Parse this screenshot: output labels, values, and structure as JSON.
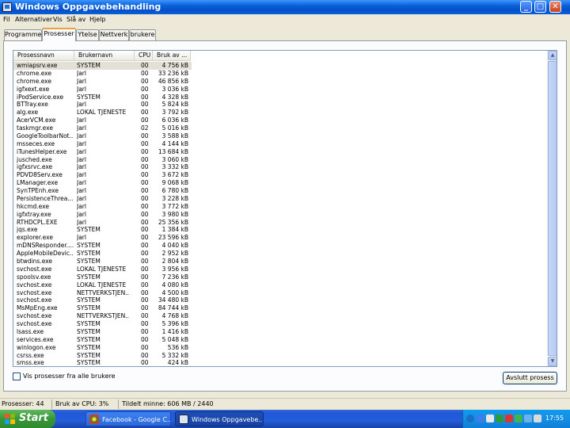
{
  "window": {
    "title": "Windows Oppgavebehandling"
  },
  "menu": {
    "items": [
      "Fil",
      "Alternativer",
      "Vis",
      "Slå av",
      "Hjelp"
    ]
  },
  "tabs": [
    {
      "label": "Programmer",
      "active": false
    },
    {
      "label": "Prosesser",
      "active": true
    },
    {
      "label": "Ytelse",
      "active": false
    },
    {
      "label": "Nettverk",
      "active": false
    },
    {
      "label": "brukere",
      "active": false
    }
  ],
  "table": {
    "columns": [
      "Prosessnavn",
      "Brukernavn",
      "CPU",
      "Bruk av ..."
    ],
    "rows": [
      [
        "wmiapsrv.exe",
        "SYSTEM",
        "00",
        "4 756 kB"
      ],
      [
        "chrome.exe",
        "Jarl",
        "00",
        "33 236 kB"
      ],
      [
        "chrome.exe",
        "Jarl",
        "00",
        "46 856 kB"
      ],
      [
        "igfxext.exe",
        "Jarl",
        "00",
        "3 036 kB"
      ],
      [
        "iPodService.exe",
        "SYSTEM",
        "00",
        "4 328 kB"
      ],
      [
        "BTTray.exe",
        "Jarl",
        "00",
        "5 824 kB"
      ],
      [
        "alg.exe",
        "LOKAL TJENESTE",
        "00",
        "3 792 kB"
      ],
      [
        "AcerVCM.exe",
        "Jarl",
        "00",
        "6 036 kB"
      ],
      [
        "taskmgr.exe",
        "Jarl",
        "02",
        "5 016 kB"
      ],
      [
        "GoogleToolbarNot...",
        "Jarl",
        "00",
        "3 588 kB"
      ],
      [
        "msseces.exe",
        "Jarl",
        "00",
        "4 144 kB"
      ],
      [
        "iTunesHelper.exe",
        "Jarl",
        "00",
        "13 684 kB"
      ],
      [
        "jusched.exe",
        "Jarl",
        "00",
        "3 060 kB"
      ],
      [
        "igfxsrvc.exe",
        "Jarl",
        "00",
        "3 332 kB"
      ],
      [
        "PDVD8Serv.exe",
        "Jarl",
        "00",
        "3 672 kB"
      ],
      [
        "LManager.exe",
        "Jarl",
        "00",
        "9 068 kB"
      ],
      [
        "SynTPEnh.exe",
        "Jarl",
        "00",
        "6 780 kB"
      ],
      [
        "PersistenceThrea...",
        "Jarl",
        "00",
        "3 228 kB"
      ],
      [
        "hkcmd.exe",
        "Jarl",
        "00",
        "3 772 kB"
      ],
      [
        "igfxtray.exe",
        "Jarl",
        "00",
        "3 980 kB"
      ],
      [
        "RTHDCPL.EXE",
        "Jarl",
        "00",
        "25 356 kB"
      ],
      [
        "jqs.exe",
        "SYSTEM",
        "00",
        "1 384 kB"
      ],
      [
        "explorer.exe",
        "Jarl",
        "00",
        "23 596 kB"
      ],
      [
        "mDNSResponder....",
        "SYSTEM",
        "00",
        "4 040 kB"
      ],
      [
        "AppleMobileDevic...",
        "SYSTEM",
        "00",
        "2 952 kB"
      ],
      [
        "btwdins.exe",
        "SYSTEM",
        "00",
        "2 804 kB"
      ],
      [
        "svchost.exe",
        "LOKAL TJENESTE",
        "00",
        "3 956 kB"
      ],
      [
        "spoolsv.exe",
        "SYSTEM",
        "00",
        "7 236 kB"
      ],
      [
        "svchost.exe",
        "LOKAL TJENESTE",
        "00",
        "4 080 kB"
      ],
      [
        "svchost.exe",
        "NETTVERKSTJEN...",
        "00",
        "4 500 kB"
      ],
      [
        "svchost.exe",
        "SYSTEM",
        "00",
        "34 480 kB"
      ],
      [
        "MsMpEng.exe",
        "SYSTEM",
        "00",
        "84 744 kB"
      ],
      [
        "svchost.exe",
        "NETTVERKSTJEN...",
        "00",
        "4 768 kB"
      ],
      [
        "svchost.exe",
        "SYSTEM",
        "00",
        "5 396 kB"
      ],
      [
        "lsass.exe",
        "SYSTEM",
        "00",
        "1 416 kB"
      ],
      [
        "services.exe",
        "SYSTEM",
        "00",
        "5 048 kB"
      ],
      [
        "winlogon.exe",
        "SYSTEM",
        "00",
        "536 kB"
      ],
      [
        "csrss.exe",
        "SYSTEM",
        "00",
        "5 332 kB"
      ],
      [
        "smss.exe",
        "SYSTEM",
        "00",
        "424 kB"
      ]
    ]
  },
  "options": {
    "show_all_label": "Vis prosesser fra alle brukere",
    "show_all_checked": false
  },
  "buttons": {
    "end_process": "Avslutt prosess"
  },
  "status": {
    "processes": "Prosesser: 44",
    "cpu": "Bruk av CPU: 3%",
    "memory": "Tildelt minne: 606 MB / 2440"
  },
  "taskbar": {
    "start_label": "Start",
    "buttons": [
      {
        "label": "Facebook - Google C...",
        "active": false
      },
      {
        "label": "Windows Oppgavebe...",
        "active": true
      }
    ],
    "clock": "17:55"
  },
  "colors": {
    "titlebar": "#0a5fd8",
    "taskbar": "#245edb",
    "start": "#379637",
    "tray": "#1592e6"
  }
}
